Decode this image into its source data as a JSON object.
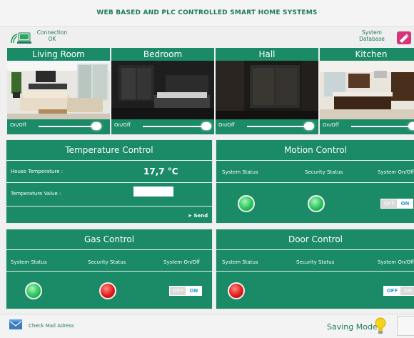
{
  "app": {
    "title": "WEB BASED AND PLC CONTROLLED SMART HOME SYSTEMS"
  },
  "header": {
    "connection_label": "Connection",
    "connection_status": "OK",
    "system_label": "System",
    "database_label": "Database"
  },
  "rooms": [
    {
      "name": "Living Room",
      "onoff_label": "On/Off",
      "switch_on": true
    },
    {
      "name": "Bedroom",
      "onoff_label": "On/Off",
      "switch_on": true
    },
    {
      "name": "Hall",
      "onoff_label": "On/Off",
      "switch_on": true
    },
    {
      "name": "Kitchen",
      "onoff_label": "On/Off",
      "switch_on": true
    }
  ],
  "temperature": {
    "title": "Temperature Control",
    "house_label": "House Temperature :",
    "house_value": "17,7 °C",
    "value_label": "Temperature Value :",
    "value_input": "",
    "send_label": "Send"
  },
  "motion": {
    "title": "Motion Control",
    "system_status": "System Status",
    "security_status": "Security Status",
    "system_onoff": "System On/Off",
    "system_led": "green",
    "security_led": "green",
    "toggle_off": "OFF",
    "toggle_on": "ON",
    "toggle_state": "on"
  },
  "gas": {
    "title": "Gas Control",
    "system_status": "System Status",
    "security_status": "Security Status",
    "system_onoff": "System On/Off",
    "system_led": "green",
    "security_led": "red",
    "toggle_off": "OFF",
    "toggle_on": "ON",
    "toggle_state": "on"
  },
  "door": {
    "title": "Door Control",
    "system_status": "System Status",
    "security_status": "Security Status",
    "system_onoff": "System On/Off",
    "system_led": "red",
    "toggle_off": "OFF",
    "toggle_on": "ON",
    "toggle_state": "off"
  },
  "footer": {
    "mail_label": "Check Mail Adress",
    "saving_label": "Saving Mode"
  },
  "colors": {
    "panel": "#1b8a67",
    "accent_text": "#1f7a5a",
    "toggle_active": "#2a9ad6",
    "led_green": "#27c45a",
    "led_red": "#e31b1b"
  }
}
